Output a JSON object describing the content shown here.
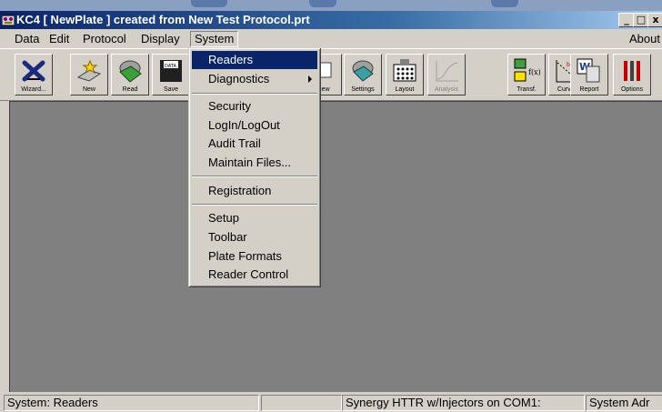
{
  "window": {
    "title": "KC4   [ NewPlate ] created from New Test Protocol.prt",
    "controls": [
      "_",
      "□",
      "x"
    ]
  },
  "menubar": {
    "items": [
      "Data",
      "Edit",
      "Protocol",
      "Display",
      "System"
    ],
    "about": "About"
  },
  "toolbar": {
    "buttons": [
      "Wizard...",
      "New",
      "Read",
      "Save",
      "View",
      "Settings",
      "Layout",
      "Analysis",
      "Transf.",
      "Curves",
      "Report",
      "Options"
    ]
  },
  "system_menu": {
    "items": [
      {
        "label": "Readers",
        "highlighted": true
      },
      {
        "label": "Diagnostics",
        "submenu": true
      },
      {
        "label": "Security"
      },
      {
        "label": "LogIn/LogOut"
      },
      {
        "label": "Audit Trail"
      },
      {
        "label": "Maintain Files..."
      },
      {
        "label": "Registration"
      },
      {
        "label": "Setup"
      },
      {
        "label": "Toolbar"
      },
      {
        "label": "Plate Formats"
      },
      {
        "label": "Reader Control"
      }
    ]
  },
  "statusbar": {
    "left": "System: Readers",
    "middle": "",
    "reader": "Synergy HTTR w/Injectors on COM1:",
    "right": "System Adr"
  },
  "colors": {
    "title_gradient_start": "#0a246a",
    "highlight": "#0a246a",
    "workspace": "#808080",
    "chrome": "#d4d0c8"
  }
}
